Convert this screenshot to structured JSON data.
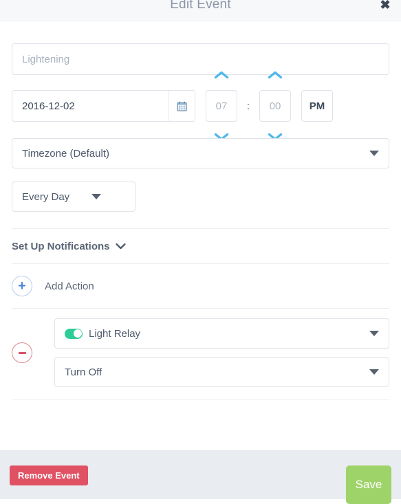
{
  "header": {
    "title": "Edit Event",
    "close_label": "✖"
  },
  "form": {
    "name": {
      "value": "",
      "placeholder": "Lightening"
    },
    "date": {
      "value": "2016-12-02",
      "calendar_icon": "calendar-icon"
    },
    "time": {
      "hour": "07",
      "minute": "00",
      "separator": ":",
      "meridiem": "PM",
      "hour_up_icon": "chevron-up-icon",
      "hour_down_icon": "chevron-down-icon",
      "minute_up_icon": "chevron-up-icon",
      "minute_down_icon": "chevron-down-icon"
    },
    "timezone": {
      "selected": "Timezone (Default)",
      "caret_icon": "caret-down-icon"
    },
    "repeat": {
      "selected": "Every Day",
      "caret_icon": "caret-down-icon"
    },
    "notifications": {
      "label": "Set Up Notifications",
      "chevron_icon": "chevron-down-icon"
    },
    "add_action": {
      "label": "Add Action",
      "icon": "plus-circle-icon"
    },
    "actions": [
      {
        "remove_icon": "minus-circle-icon",
        "device": "Light Relay",
        "device_toggle_on": true,
        "device_caret_icon": "caret-down-icon",
        "command": "Turn Off",
        "command_caret_icon": "caret-down-icon"
      }
    ]
  },
  "footer": {
    "remove_label": "Remove Event",
    "save_label": "Save"
  },
  "colors": {
    "header_bg": "#f7f8fa",
    "accent_blue": "#4fb8e8",
    "add_blue": "#4a86d8",
    "toggle_green": "#2ecc96",
    "danger_red": "#e05263",
    "save_green": "#9ed36a",
    "border": "#dfe3e9",
    "text": "#4d5a6b",
    "footer_bg": "#e9ecf0"
  }
}
